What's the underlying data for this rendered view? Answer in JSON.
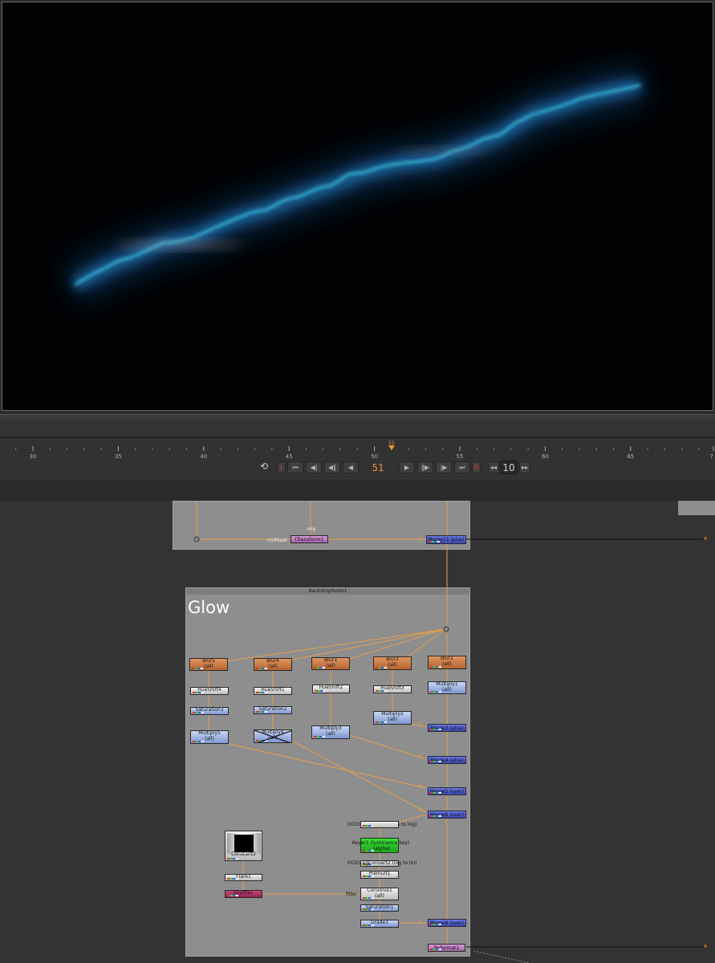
{
  "viewer": {
    "description_color": "#020305"
  },
  "timeline": {
    "ticks": [
      "30",
      "35",
      "40",
      "45",
      "50",
      "55",
      "60",
      "65",
      "7"
    ],
    "current_marker": "51",
    "current_frame": "51",
    "step": "10"
  },
  "colors": {
    "wire": "#e8a04b",
    "blur_node": "#c87840",
    "merge_node": "#4652c8",
    "keyer_node": "#2ac227",
    "shuffle_node": "#b03565",
    "backdrop": "#8e8e8e",
    "accent_orange": "#f0953a"
  },
  "graph": {
    "top_backdrop": {
      "labels": {
        "mask_label": "ctrlMask",
        "img_label": "img"
      },
      "nodes": {
        "transform": "ITransform1",
        "merge": "Merge11 (plus)"
      },
      "input_letters": {
        "a1": "A",
        "a2": "A"
      }
    },
    "backdrop": {
      "title": "BackdropNode1",
      "label": "Glow"
    },
    "nodes": {
      "blur5": "Blur5",
      "blur4": "Blur4",
      "blur3": "Blur3",
      "blur2": "Blur2",
      "blur1": "Blur1",
      "all": "(all)",
      "hueshift4": "HueShift4",
      "hueshift1": "HueShift1",
      "hueshift2": "HueShift2",
      "hueshift3": "HueShift3",
      "saturation3": "Saturation3",
      "saturation2": "Saturation2",
      "multiply1": "Multiply1",
      "multiply2": "Multiply2",
      "multiply3": "Multiply3",
      "multiply4": "Multiply4",
      "multiply5": "Multiply5",
      "merge3": "Merge3 (plus)",
      "merge4": "Merge4 (plus)",
      "merge5": "Merge5 (over)",
      "merge6": "Merge6 (over)",
      "merge8": "Merge8 (over)",
      "ocio1": "OCIOLogConvert1 (lin to log)",
      "keyer1a": "Keyer1 (luminance key)",
      "keyer1b": "(alpha)",
      "ocio2": "OCIOLogConvert2 (log to lin)",
      "premult1": "Premult1",
      "convolve1": "Convolve1",
      "saturation1": "Saturation1",
      "grade1": "Grade1",
      "constant2": "Constant2",
      "flare1": "Flare1",
      "shuffle1": "Shuffle1",
      "reformat1": "Reformat1",
      "filter_label": "filter",
      "a_label": "A"
    }
  }
}
